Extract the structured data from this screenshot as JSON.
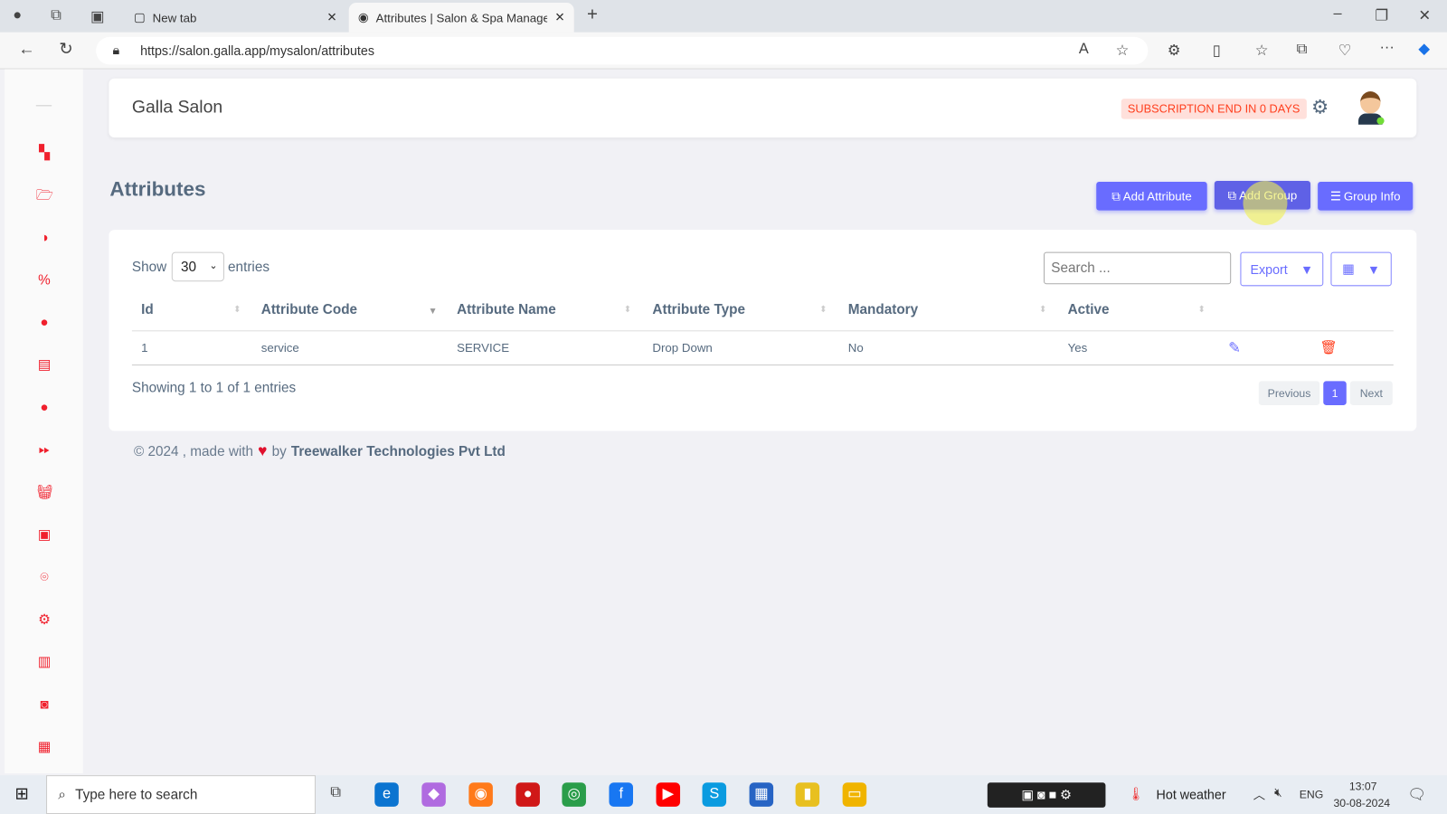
{
  "browser": {
    "tabs": [
      {
        "label": "New tab"
      },
      {
        "label": "Attributes | Salon & Spa Manager"
      }
    ],
    "url": "https://salon.galla.app/mysalon/attributes"
  },
  "header": {
    "brand": "Galla Salon",
    "subscription": "SUBSCRIPTION END IN 0 DAYS"
  },
  "page": {
    "title": "Attributes",
    "buttons": {
      "add_attribute": "Add Attribute",
      "add_group": "Add Group",
      "group_info": "Group Info"
    }
  },
  "table": {
    "show": "Show",
    "entries_value": "30",
    "entries": "entries",
    "search_placeholder": "Search ...",
    "export": "Export",
    "columns": [
      "Id",
      "Attribute Code",
      "Attribute Name",
      "Attribute Type",
      "Mandatory",
      "Active"
    ],
    "rows": [
      [
        "1",
        "service",
        "SERVICE",
        "Drop Down",
        "No",
        "Yes"
      ]
    ],
    "info": "Showing 1 to 1 of 1 entries",
    "pagination": {
      "previous": "Previous",
      "page": "1",
      "next": "Next"
    }
  },
  "footer": {
    "prefix": "© 2024 , made with",
    "by": "by",
    "company": "Treewalker Technologies Pvt Ltd"
  },
  "taskbar": {
    "search": "Type here to search",
    "weather": "Hot weather",
    "lang": "ENG",
    "time": "13:07",
    "date": "30-08-2024"
  },
  "colors": {
    "accent": "#696cff",
    "sidebar_icons": "#f0202d",
    "badge_bg": "#ffe0db",
    "badge_text": "#ff3e1d"
  }
}
